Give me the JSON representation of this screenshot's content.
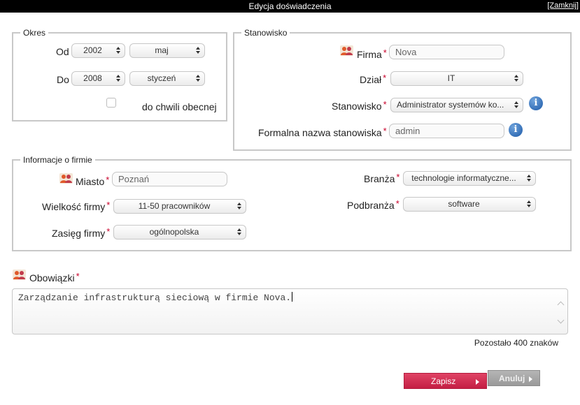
{
  "window": {
    "title": "Edycja doświadczenia",
    "close_label": "[Zamknij]"
  },
  "okres": {
    "legend": "Okres",
    "od_label": "Od",
    "od_year": "2002",
    "od_month": "maj",
    "do_label": "Do",
    "do_year": "2008",
    "do_month": "styczeń",
    "current_label": "do chwili obecnej"
  },
  "stanowisko": {
    "legend": "Stanowisko",
    "firma_label": "Firma",
    "firma_value": "Nova",
    "dzial_label": "Dział",
    "dzial_value": "IT",
    "stanowisko_label": "Stanowisko",
    "stanowisko_value": "Administrator systemów ko...",
    "formal_label": "Formalna nazwa stanowiska",
    "formal_value": "admin",
    "info_glyph": "i"
  },
  "firma_info": {
    "legend": "Informacje o firmie",
    "miasto_label": "Miasto",
    "miasto_value": "Poznań",
    "wielkosc_label": "Wielkość firmy",
    "wielkosc_value": "11-50 pracowników",
    "zasieg_label": "Zasięg firmy",
    "zasieg_value": "ogólnopolska",
    "branza_label": "Branża",
    "branza_value": "technologie informatyczne...",
    "podbranza_label": "Podbranża",
    "podbranza_value": "software"
  },
  "obowiazki": {
    "label": "Obowiązki",
    "text": "Zarządzanie infrastrukturą sieciową w firmie Nova.",
    "remaining": "Pozostało 400 znaków"
  },
  "required_mark": "*",
  "buttons": {
    "save": "Zapisz",
    "cancel": "Anuluj"
  },
  "colors": {
    "accent": "#c41f44",
    "required": "#c8002a",
    "info": "#1d5aa8"
  }
}
